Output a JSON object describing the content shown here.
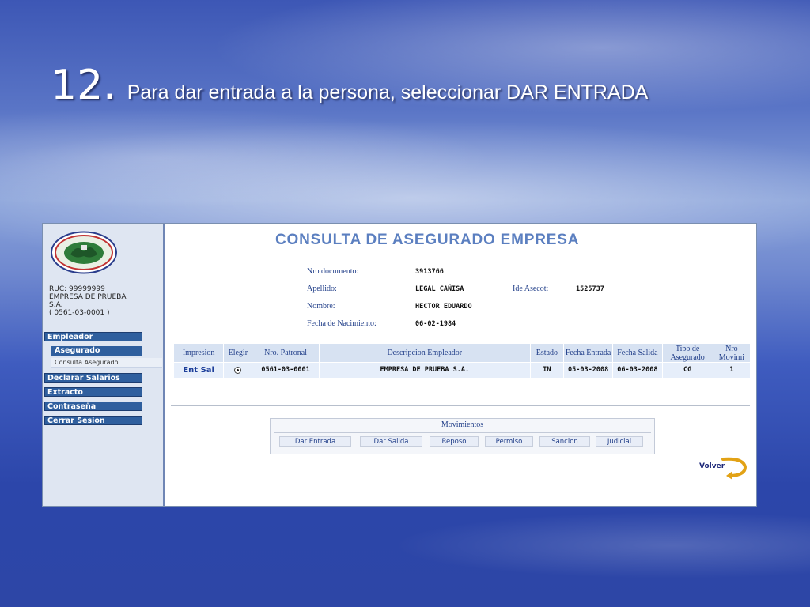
{
  "slide": {
    "number": "12.",
    "instruction": "Para dar entrada a la persona, seleccionar DAR ENTRADA"
  },
  "sidebar": {
    "logo_text": "INSTITUTO DE PREVISION SOCIAL PARAGUAY",
    "company": {
      "ruc": "RUC: 99999999",
      "name1": "EMPRESA DE PRUEBA",
      "name2": "S.A.",
      "code": "( 0561-03-0001 )"
    },
    "menu": {
      "empleador": "Empleador",
      "asegurado": "Asegurado",
      "consulta_asegurado": "Consulta Asegurado",
      "declarar_salarios": "Declarar Salarios",
      "extracto": "Extracto",
      "contrasena": "Contraseña",
      "cerrar_sesion": "Cerrar Sesion"
    }
  },
  "main": {
    "title": "CONSULTA DE ASEGURADO EMPRESA",
    "fields": {
      "nro_documento_label": "Nro documento:",
      "nro_documento": "3913766",
      "apellido_label": "Apellido:",
      "apellido": "LEGAL CAÑISA",
      "ide_asecot_label": "Ide Asecot:",
      "ide_asecot": "1525737",
      "nombre_label": "Nombre:",
      "nombre": "HECTOR EDUARDO",
      "fecha_nac_label": "Fecha de Nacimiento:",
      "fecha_nac": "06-02-1984"
    },
    "table": {
      "headers": {
        "impresion": "Impresion",
        "elegir": "Elegir",
        "nro_patronal": "Nro. Patronal",
        "descripcion": "Descripcion Empleador",
        "estado": "Estado",
        "fecha_entrada": "Fecha Entrada",
        "fecha_salida": "Fecha Salida",
        "tipo_asegurado": "Tipo de Asegurado",
        "nro_movimi": "Nro Movimi"
      },
      "rows": [
        {
          "impresion": "Ent Sal",
          "nro_patronal": "0561-03-0001",
          "descripcion": "EMPRESA DE PRUEBA S.A.",
          "estado": "IN",
          "fecha_entrada": "05-03-2008",
          "fecha_salida": "06-03-2008",
          "tipo_asegurado": "CG",
          "nro_movimi": "1"
        }
      ]
    },
    "movimientos": {
      "title": "Movimientos",
      "buttons": {
        "dar_entrada": "Dar Entrada",
        "dar_salida": "Dar Salida",
        "reposo": "Reposo",
        "permiso": "Permiso",
        "sancion": "Sancion",
        "judicial": "Judicial"
      }
    },
    "volver": "Volver"
  },
  "colors": {
    "accent": "#2f5f9e",
    "title": "#5b7fc0",
    "label": "#23408a"
  }
}
